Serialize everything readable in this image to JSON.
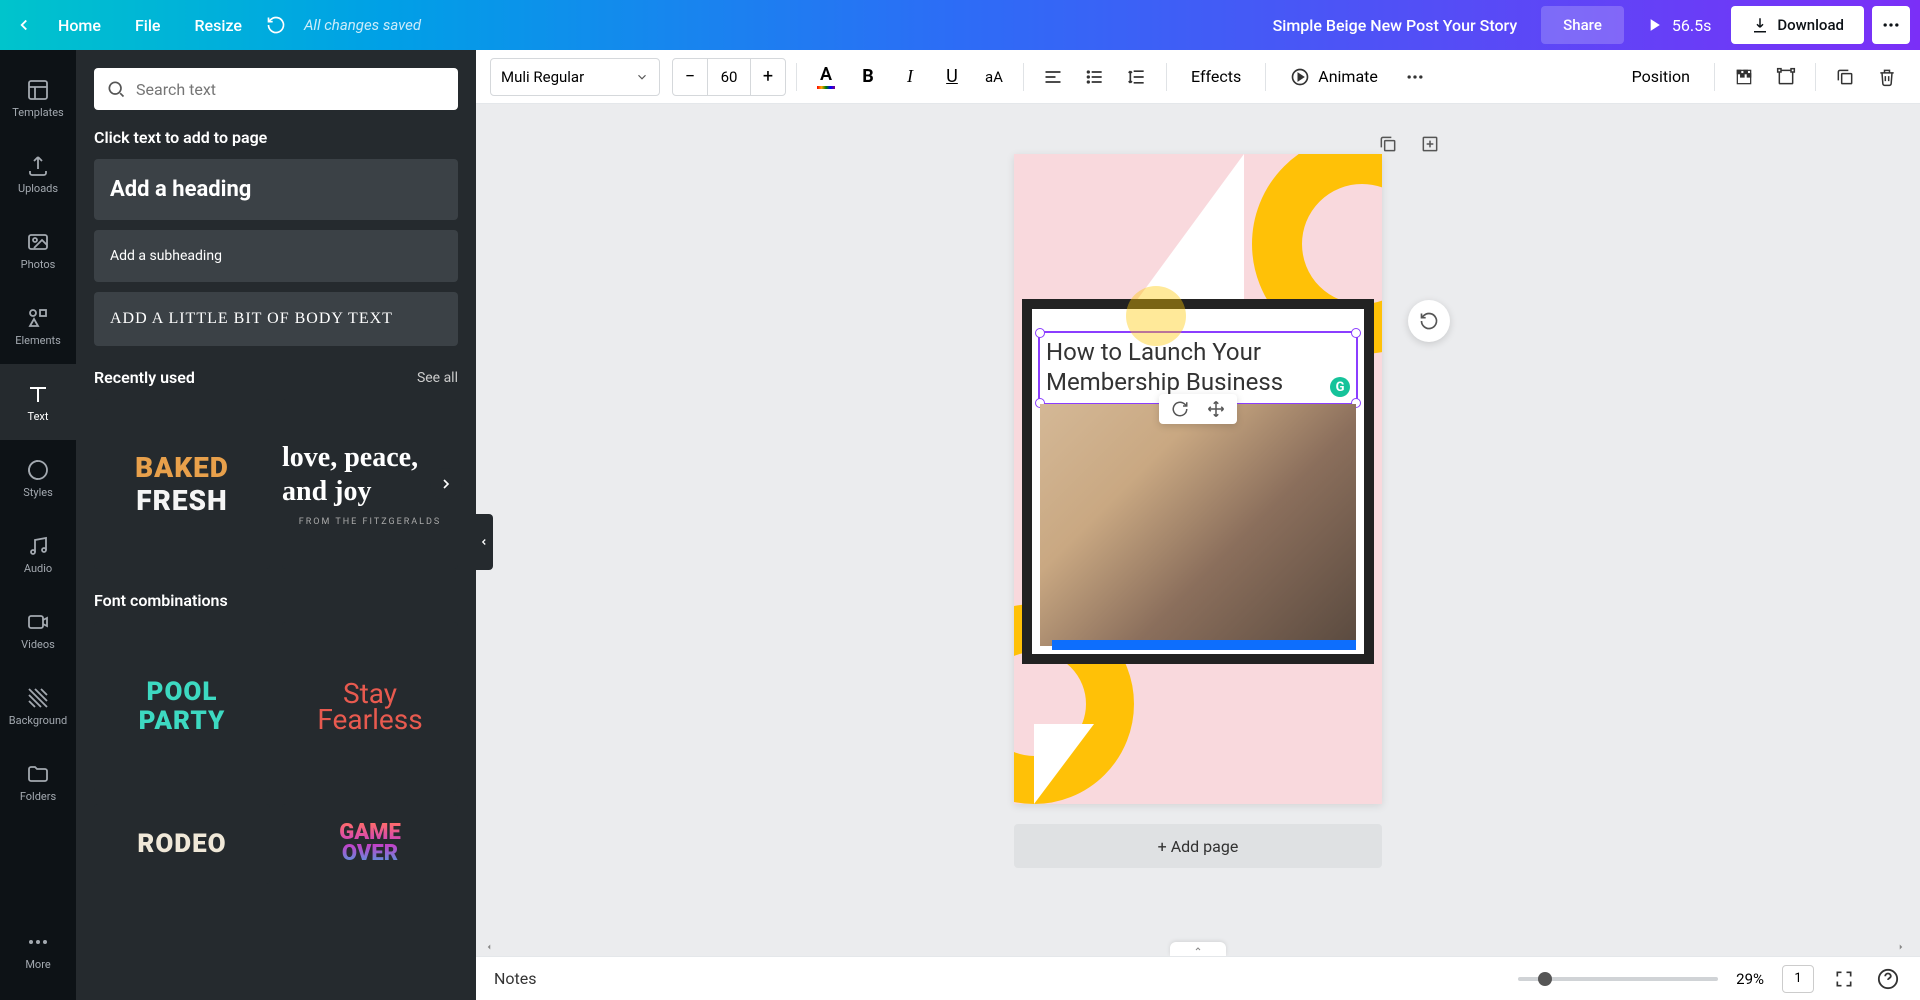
{
  "topbar": {
    "home": "Home",
    "file": "File",
    "resize": "Resize",
    "saved": "All changes saved",
    "doc_title": "Simple Beige New Post Your Story",
    "share": "Share",
    "duration": "56.5s",
    "download": "Download"
  },
  "rail": {
    "templates": "Templates",
    "uploads": "Uploads",
    "photos": "Photos",
    "elements": "Elements",
    "text": "Text",
    "styles": "Styles",
    "audio": "Audio",
    "videos": "Videos",
    "background": "Background",
    "folders": "Folders",
    "more": "More"
  },
  "panel": {
    "search_placeholder": "Search text",
    "click_label": "Click text to add to page",
    "heading": "Add a heading",
    "subheading": "Add a subheading",
    "body": "Add a little bit of body text",
    "recent_title": "Recently used",
    "see_all": "See all",
    "combos_title": "Font combinations",
    "baked1": "BAKED",
    "baked2": "FRESH",
    "love": "love, peace, and joy",
    "love_sub": "FROM THE FITZGERALDS",
    "pool1": "POOL",
    "pool2": "PARTY",
    "fearless1": "Stay",
    "fearless2": "Fearless",
    "rodeo": "RODEO",
    "game1": "GAME",
    "game2": "OVER"
  },
  "toolbar": {
    "font": "Muli Regular",
    "size": "60",
    "effects": "Effects",
    "animate": "Animate",
    "position": "Position"
  },
  "canvas": {
    "text_content": "How to Launch Your Membership Business",
    "grammarly": "G",
    "add_page": "+ Add page"
  },
  "bottom": {
    "notes": "Notes",
    "zoom": "29%",
    "page_num": "1"
  }
}
